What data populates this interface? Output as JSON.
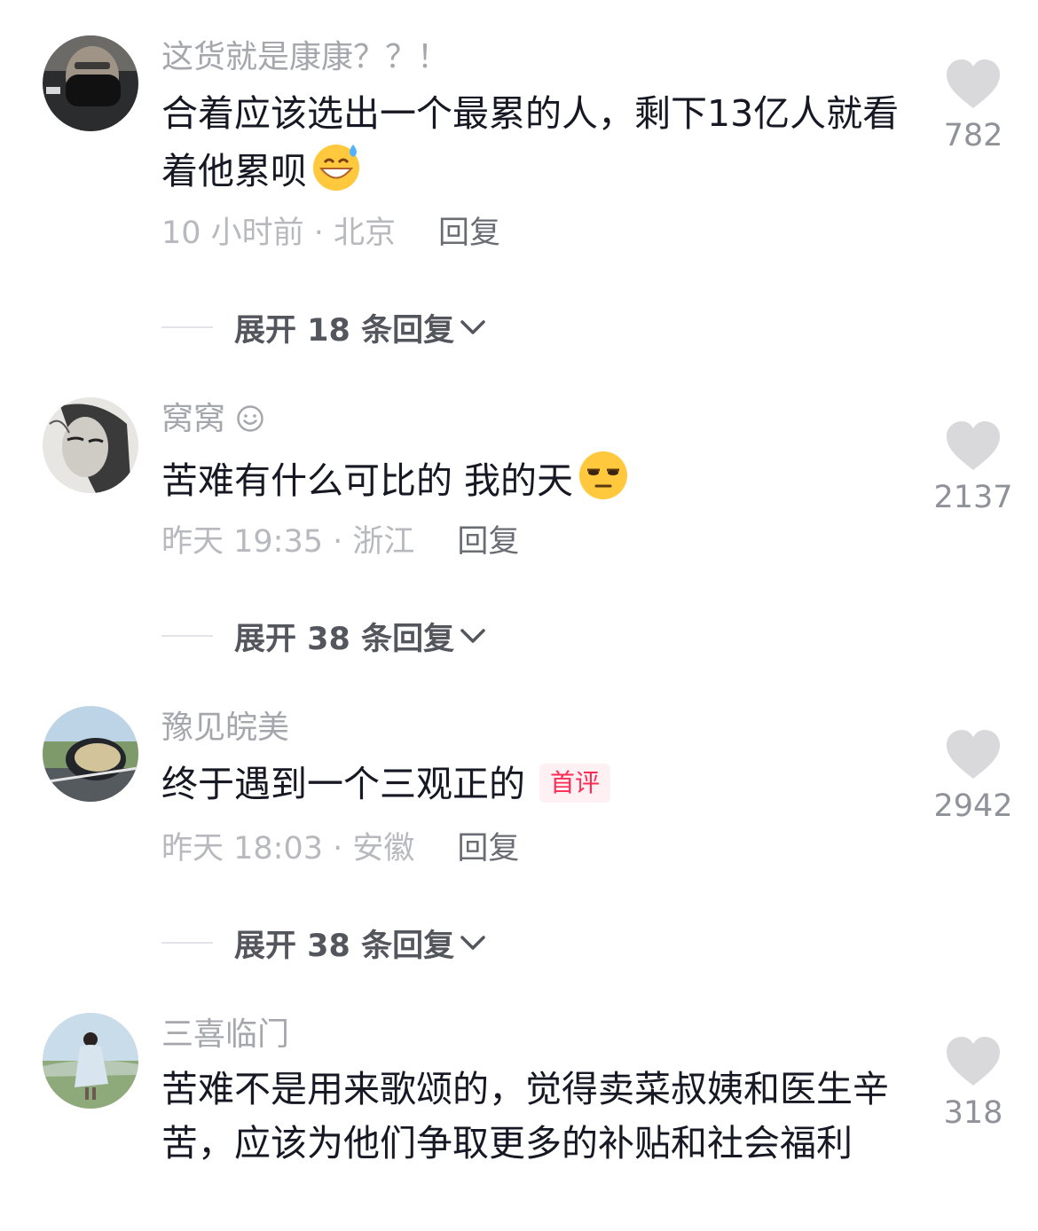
{
  "comments": [
    {
      "username": "这货就是康康？？！",
      "content": "合着应该选出一个最累的人，剩下13亿人就看着他累呗",
      "emoji": "grinning-sweat-emoji",
      "time": "10小时前",
      "location": "北京",
      "meta": "10 小时前 · 北京",
      "reply_label": "回复",
      "likes": "782",
      "expand_label": "展开 18 条回复"
    },
    {
      "username": "窝窝",
      "username_icon": "smile-icon",
      "content": "苦难有什么可比的 我的天",
      "emoji": "unamused-face-emoji",
      "meta": "昨天 19:35 · 浙江",
      "reply_label": "回复",
      "likes": "2137",
      "expand_label": "展开 38 条回复"
    },
    {
      "username": "豫见皖美",
      "content": "终于遇到一个三观正的",
      "badge": "首评",
      "meta": "昨天 18:03 · 安徽",
      "reply_label": "回复",
      "likes": "2942",
      "expand_label": "展开 38 条回复"
    },
    {
      "username": "三喜临门",
      "content": "苦难不是用来歌颂的，觉得卖菜叔姨和医生辛苦，应该为他们争取更多的补贴和社会福利",
      "likes": "318"
    }
  ],
  "colors": {
    "accent_red": "#fe2c55",
    "muted_text": "#a5a7ad",
    "heart": "#d9d9dc"
  }
}
